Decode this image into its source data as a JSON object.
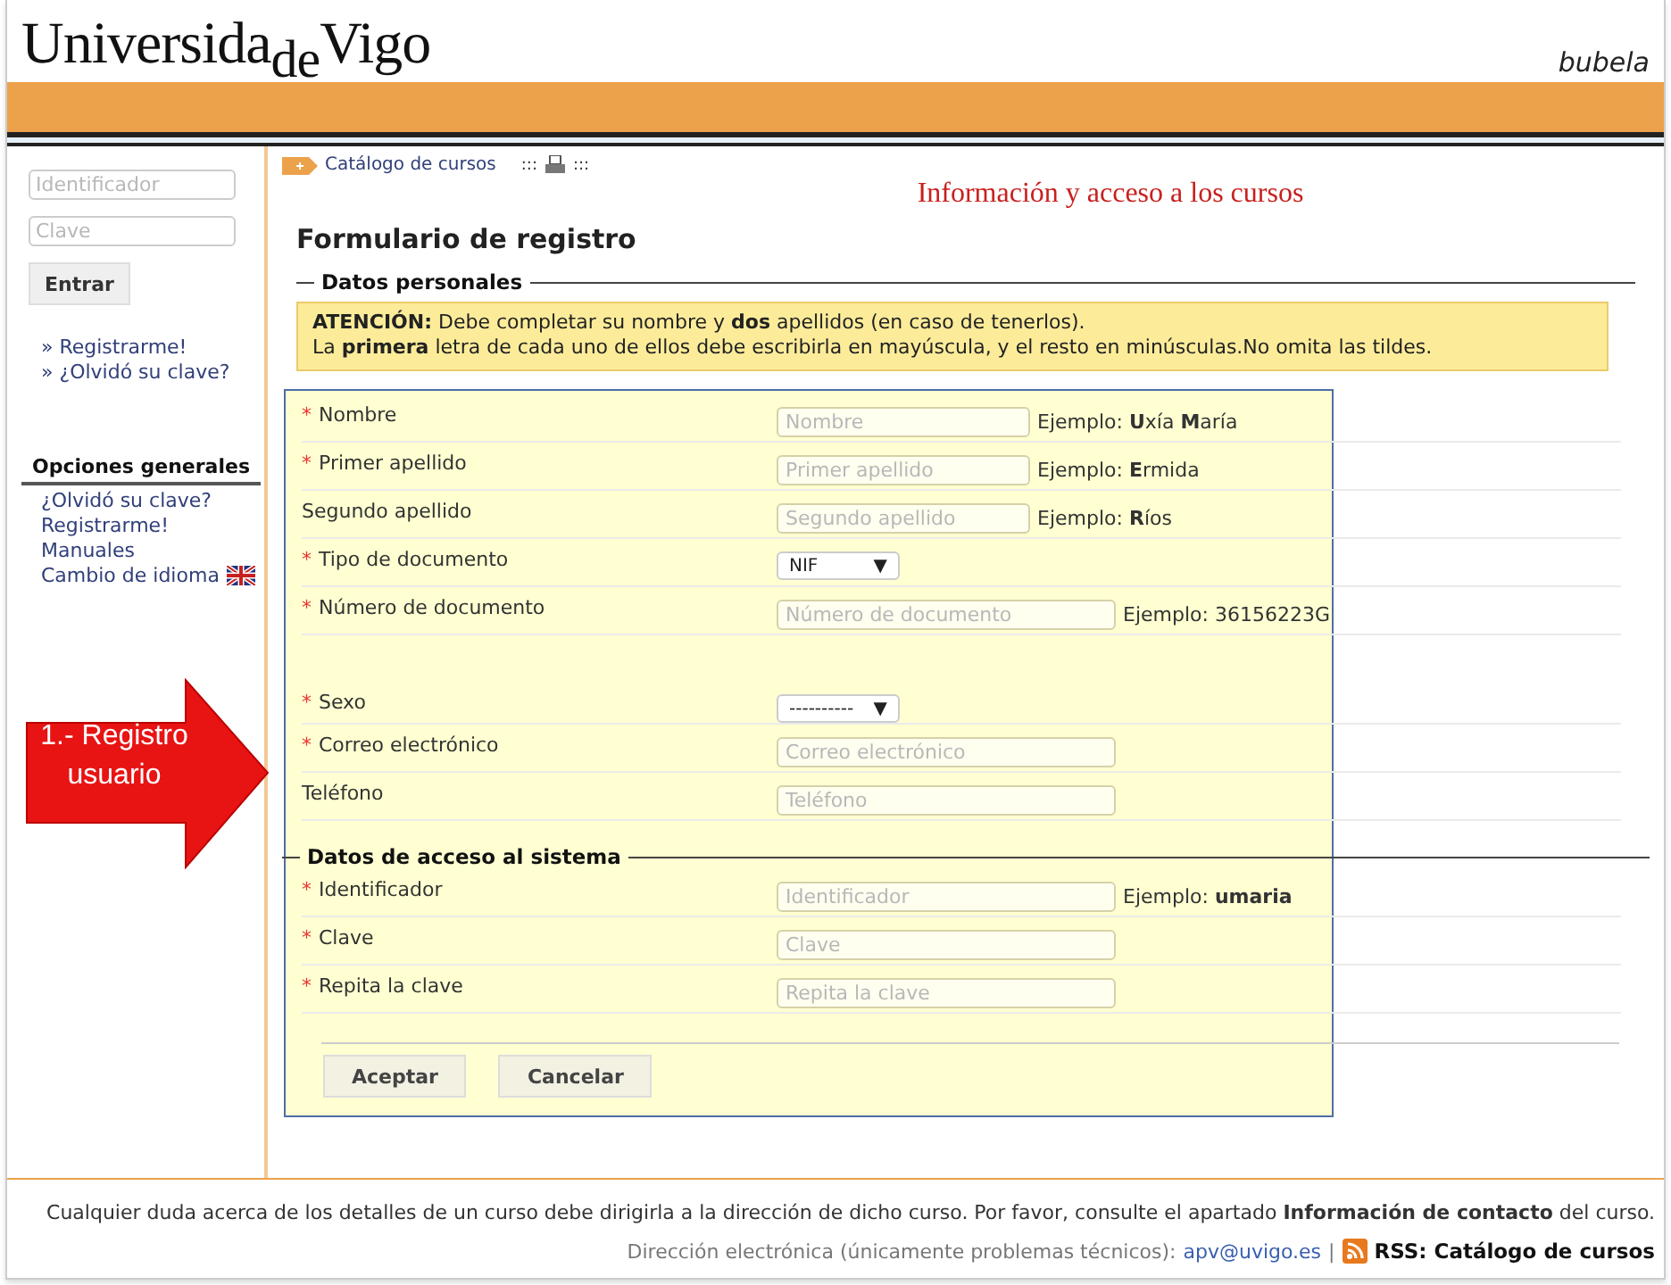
{
  "header": {
    "logo": {
      "first": "Universida",
      "middle": "de",
      "last": "Vigo"
    },
    "app_name": "bubela"
  },
  "sidebar": {
    "login": {
      "fields": [
        {
          "placeholder": "Identificador"
        },
        {
          "placeholder": "Clave"
        }
      ],
      "button": "Entrar"
    },
    "quick_links": [
      "» Registrarme!",
      "» ¿Olvidó su clave?"
    ],
    "options": {
      "title": "Opciones generales",
      "items": [
        {
          "label": "¿Olvidó su clave?",
          "flag": false
        },
        {
          "label": "Registrarme!",
          "flag": false
        },
        {
          "label": "Manuales",
          "flag": false
        },
        {
          "label": "Cambio de idioma",
          "flag": true
        }
      ]
    }
  },
  "breadcrumb": {
    "link": "Catálogo de cursos",
    "separators": [
      ":::",
      ":::"
    ]
  },
  "page_heading": "Información y acceso a los cursos",
  "required_marker": "*",
  "form_title": "Formulario de registro",
  "sections": [
    {
      "legend": "Datos personales",
      "notice": [
        "**ATENCIÓN:** Debe completar su nombre y **dos** apellidos (en caso de tenerlos).",
        "La **primera** letra de cada uno de ellos debe escribirla en mayúscula, y el resto en minúsculas.No omita las tildes."
      ],
      "fields": [
        {
          "label": "Nombre",
          "required": true,
          "kind": "short",
          "placeholder": "Nombre",
          "example": "Ejemplo: **U**xía **M**aría",
          "gap_before": false
        },
        {
          "label": "Primer apellido",
          "required": true,
          "kind": "short",
          "placeholder": "Primer apellido",
          "example": "Ejemplo: **E**rmida",
          "gap_before": false
        },
        {
          "label": "Segundo apellido",
          "required": false,
          "kind": "short",
          "placeholder": "Segundo apellido",
          "example": "Ejemplo: **R**íos",
          "gap_before": false
        },
        {
          "label": "Tipo de documento",
          "required": true,
          "kind": "select",
          "value": "NIF",
          "caret": "▼",
          "gap_before": false
        },
        {
          "label": "Número de documento",
          "required": true,
          "kind": "text",
          "placeholder": "Número de documento",
          "example": "Ejemplo: 36156223G",
          "gap_before": false
        },
        {
          "label": "Sexo",
          "required": true,
          "kind": "select",
          "value": "----------",
          "caret": "▼",
          "gap_before": true
        },
        {
          "label": "Correo electrónico",
          "required": true,
          "kind": "text",
          "placeholder": "Correo electrónico",
          "gap_before": false
        },
        {
          "label": "Teléfono",
          "required": false,
          "kind": "text",
          "placeholder": "Teléfono",
          "gap_before": false
        }
      ]
    },
    {
      "legend": "Datos de acceso al sistema",
      "fields": [
        {
          "label": "Identificador",
          "required": true,
          "kind": "text",
          "placeholder": "Identificador",
          "example": "Ejemplo: **umaria**",
          "gap_before": false
        },
        {
          "label": "Clave",
          "required": true,
          "kind": "text",
          "placeholder": "Clave",
          "gap_before": false
        },
        {
          "label": "Repita la clave",
          "required": true,
          "kind": "text",
          "placeholder": "Repita la clave",
          "gap_before": false
        }
      ]
    }
  ],
  "buttons": [
    "Aceptar",
    "Cancelar"
  ],
  "callout": {
    "text": "1.- Registro usuario"
  },
  "footer": {
    "note": "Cualquier duda acerca de los detalles de un curso debe dirigirla a la dirección de dicho curso. Por favor, consulte el apartado **Información de contacto** del curso.",
    "contact_label": "Dirección electrónica (únicamente problemas técnicos):",
    "email": "apv@uvigo.es",
    "separator": "|",
    "rss": "RSS: Catálogo de cursos"
  }
}
